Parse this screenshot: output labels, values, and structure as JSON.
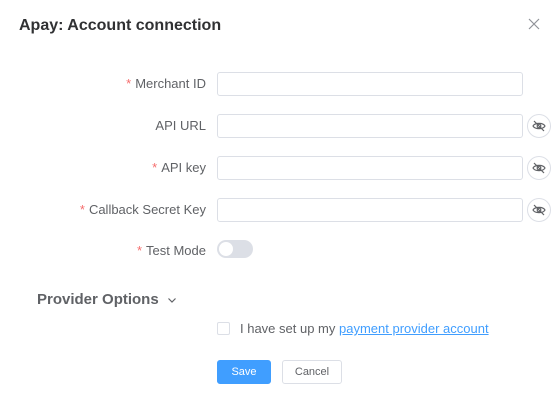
{
  "dialog": {
    "title": "Apay: Account connection"
  },
  "icons": {
    "close": "close-icon",
    "eye": "eye-slash-icon",
    "chevron": "chevron-down-icon"
  },
  "fields": {
    "merchant_id": {
      "label": "Merchant ID",
      "required": "*",
      "value": ""
    },
    "api_url": {
      "label": "API URL",
      "value": ""
    },
    "api_key": {
      "label": "API key",
      "required": "*",
      "value": ""
    },
    "callback_secret_key": {
      "label": "Callback Secret Key",
      "required": "*",
      "value": ""
    },
    "test_mode": {
      "label": "Test Mode",
      "required": "*",
      "enabled": false
    }
  },
  "provider_options": {
    "label": "Provider Options"
  },
  "confirm": {
    "text": "I have set up my ",
    "link": "payment provider account",
    "checked": false
  },
  "buttons": {
    "save": "Save",
    "cancel": "Cancel"
  },
  "colors": {
    "primary": "#409eff",
    "required": "#f56c6c",
    "border": "#dcdfe6"
  }
}
